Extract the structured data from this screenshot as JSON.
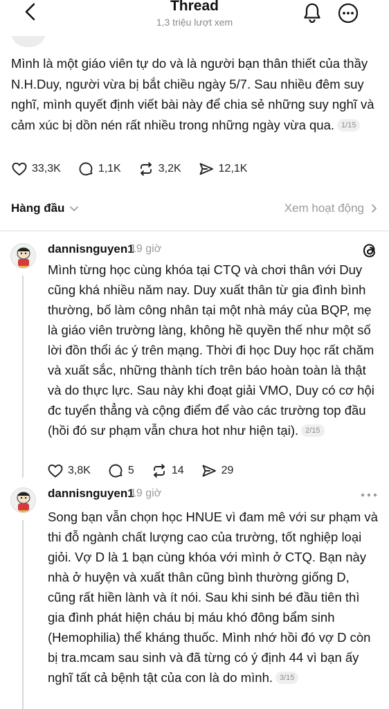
{
  "header": {
    "title": "Thread",
    "views": "1,3 triệu lượt xem",
    "icons": [
      "chevron-left-icon",
      "bell-icon",
      "more-icon"
    ]
  },
  "post": {
    "text": "Mình là một giáo viên tự do và là người bạn thân thiết của thầy N.H.Duy, người vừa bị bắt chiều ngày 5/7. Sau nhiều đêm suy nghĩ, mình quyết định viết bài này để chia sẻ những suy nghĩ và cảm xúc bị dồn nén rất nhiều trong những ngày vừa qua.",
    "page": "1/15",
    "likes": "33,3K",
    "comments": "1,1K",
    "reposts": "3,2K",
    "shares": "12,1K"
  },
  "sort": {
    "label": "Hàng đầu",
    "activity_label": "Xem hoạt động"
  },
  "replies": [
    {
      "username": "dannisnguyen1",
      "time": "19 giờ",
      "text": "Mình từng học cùng khóa tại CTQ và chơi thân với Duy cũng khá nhiều năm nay. Duy xuất thân từ gia đình bình thường, bố làm công nhân tại một nhà máy của BQP, mẹ là giáo viên trường làng, không hề quyền thế như một số lời đồn thổi ác ý trên mạng. Thời đi học Duy học rất chăm và xuất sắc, những thành tích trên báo hoàn toàn là thật và do thực lực. Sau này khi đoạt giải VMO, Duy có cơ hội đc tuyển thẳng và cộng điểm để vào các trường top đầu (hồi đó sư phạm vẫn chưa hot như hiện tại).",
      "page": "2/15",
      "likes": "3,8K",
      "comments": "5",
      "reposts": "14",
      "shares": "29"
    },
    {
      "username": "dannisnguyen1",
      "time": "19 giờ",
      "text": "Song bạn vẫn chọn học HNUE vì đam mê với sư phạm và thi đỗ ngành chất lượng cao của trường, tốt nghiệp loại giỏi. Vợ D là 1 bạn cùng khóa với mình ở CTQ. Bạn này nhà ở huyện và xuất thân cũng bình thường giống D, cũng rất hiền lành và ít nói. Sau khi sinh bé đầu tiên thì gia đình phát hiện cháu bị máu khó đông bẩm sinh (Hemophilia) thể kháng thuốc. Mình nhớ hồi đó vợ D còn bị tra.mcam sau sinh và đã từng có ý định 44 vì bạn ấy nghĩ tất cả bệnh tật của con là do mình.",
      "page": "3/15"
    }
  ]
}
